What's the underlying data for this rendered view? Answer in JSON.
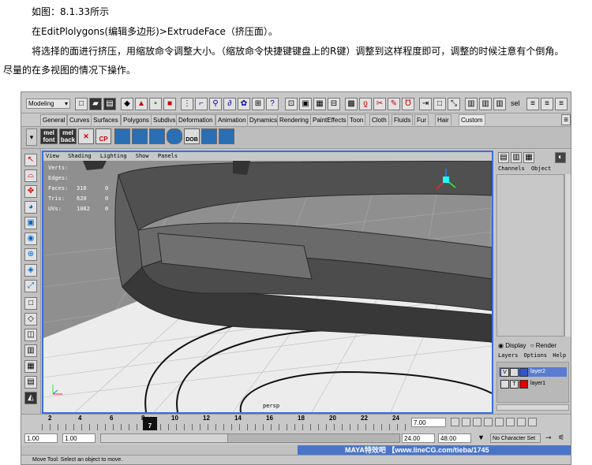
{
  "article": {
    "line1": "如图：8.1.33所示",
    "line2": "在EditPlolygons(编辑多边形)>ExtrudeFace（挤压面）。",
    "line3": "将选择的面进行挤压，用缩放命令调整大小。（缩放命令快捷键键盘上的R键）调整到这样程度即可，调整的时候注意有个倒角。",
    "line4": "尽量的在多视图的情况下操作。"
  },
  "maya": {
    "mode_select": "Modeling",
    "sel_label": "sel",
    "shelf_tabs": [
      "General",
      "Curves",
      "Surfaces",
      "Polygons",
      "Subdivs",
      "Deformation",
      "Animation",
      "Dynamics",
      "Rendering",
      "PaintEffects",
      "Toon",
      "Cloth",
      "Fluids",
      "Fur",
      "Hair",
      "Custom"
    ],
    "active_tab": "Custom",
    "shelf_buttons": {
      "mel_font_top": "mel",
      "mel_font_bottom": "font",
      "mel_back_top": "mel",
      "mel_back_bottom": "back",
      "cp": "CP",
      "dob": "DOB"
    },
    "viewport": {
      "menu": [
        "View",
        "Shading",
        "Lighting",
        "Show",
        "Panels"
      ],
      "hud": [
        {
          "label": "Verts:",
          "v1": "",
          "v2": ""
        },
        {
          "label": "Edges:",
          "v1": "",
          "v2": ""
        },
        {
          "label": "Faces:",
          "v1": "318",
          "v2": "0"
        },
        {
          "label": "Tris:",
          "v1": "620",
          "v2": "0"
        },
        {
          "label": "UVs:",
          "v1": "1082",
          "v2": "0"
        }
      ],
      "camera": "persp"
    },
    "channel_box": {
      "menu": [
        "Channels",
        "Object"
      ]
    },
    "layer_panel": {
      "display": "Display",
      "render": "Render",
      "menu": [
        "Layers",
        "Options",
        "Help"
      ],
      "layers": [
        {
          "v": "V",
          "name": "layer2",
          "color": "#3355cc",
          "selected": true
        },
        {
          "v": "",
          "t": "T",
          "name": "layer1",
          "color": "#dd0000",
          "selected": false
        }
      ]
    },
    "timeline": {
      "ticks": [
        "2",
        "4",
        "6",
        "8",
        "10",
        "12",
        "14",
        "16",
        "18",
        "20",
        "22",
        "24"
      ],
      "current_frame": "7",
      "current_time": "7.00"
    },
    "range": {
      "start": "1.00",
      "start2": "1.00",
      "end1": "24.00",
      "end2": "48.00",
      "char_set": "No Character Set"
    },
    "help_line": "Move Tool: Select an object to move.",
    "watermark": "MAYA特效吧 【www.lineCG.com/tieba/1745"
  }
}
